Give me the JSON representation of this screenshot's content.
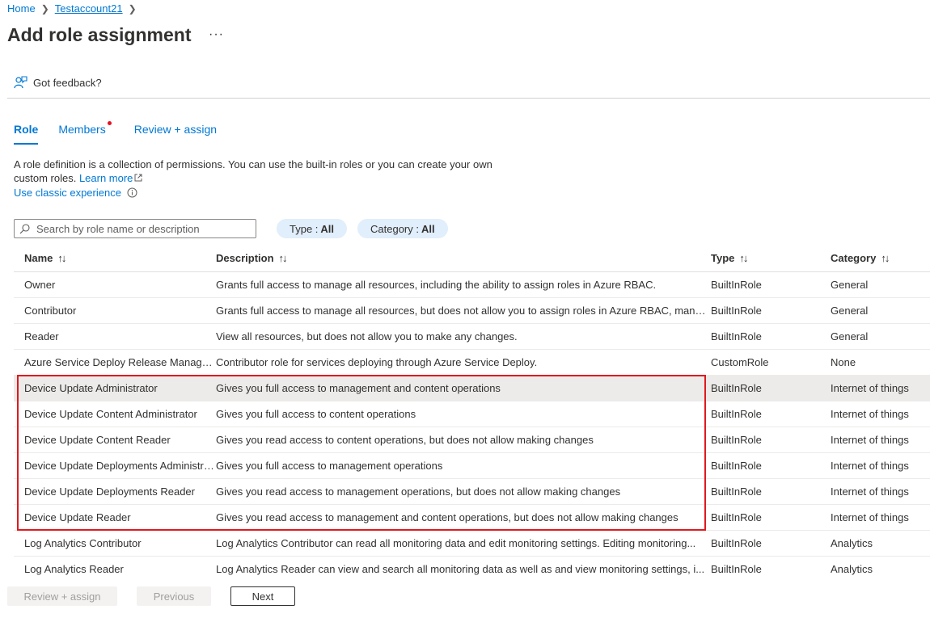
{
  "breadcrumb": {
    "home": "Home",
    "current": "Testaccount21"
  },
  "page": {
    "title": "Add role assignment",
    "more": "···"
  },
  "feedback": {
    "label": "Got feedback?"
  },
  "tabs": [
    {
      "label": "Role"
    },
    {
      "label": "Members"
    },
    {
      "label": "Review + assign"
    }
  ],
  "intro": {
    "text": "A role definition is a collection of permissions. You can use the built-in roles or you can create your own custom roles.",
    "learn_more": "Learn more",
    "classic": "Use classic experience"
  },
  "search": {
    "placeholder": "Search by role name or description"
  },
  "filters": {
    "type": {
      "label": "Type :",
      "value": "All"
    },
    "category": {
      "label": "Category :",
      "value": "All"
    }
  },
  "table": {
    "headers": {
      "name": "Name",
      "description": "Description",
      "type": "Type",
      "category": "Category"
    },
    "rows": [
      {
        "name": "Owner",
        "description": "Grants full access to manage all resources, including the ability to assign roles in Azure RBAC.",
        "type": "BuiltInRole",
        "category": "General"
      },
      {
        "name": "Contributor",
        "description": "Grants full access to manage all resources, but does not allow you to assign roles in Azure RBAC, manag...",
        "type": "BuiltInRole",
        "category": "General"
      },
      {
        "name": "Reader",
        "description": "View all resources, but does not allow you to make any changes.",
        "type": "BuiltInRole",
        "category": "General"
      },
      {
        "name": "Azure Service Deploy Release Managem...",
        "description": "Contributor role for services deploying through Azure Service Deploy.",
        "type": "CustomRole",
        "category": "None"
      },
      {
        "name": "Device Update Administrator",
        "description": "Gives you full access to management and content operations",
        "type": "BuiltInRole",
        "category": "Internet of things"
      },
      {
        "name": "Device Update Content Administrator",
        "description": "Gives you full access to content operations",
        "type": "BuiltInRole",
        "category": "Internet of things"
      },
      {
        "name": "Device Update Content Reader",
        "description": "Gives you read access to content operations, but does not allow making changes",
        "type": "BuiltInRole",
        "category": "Internet of things"
      },
      {
        "name": "Device Update Deployments Administra...",
        "description": "Gives you full access to management operations",
        "type": "BuiltInRole",
        "category": "Internet of things"
      },
      {
        "name": "Device Update Deployments Reader",
        "description": "Gives you read access to management operations, but does not allow making changes",
        "type": "BuiltInRole",
        "category": "Internet of things"
      },
      {
        "name": "Device Update Reader",
        "description": "Gives you read access to management and content operations, but does not allow making changes",
        "type": "BuiltInRole",
        "category": "Internet of things"
      },
      {
        "name": "Log Analytics Contributor",
        "description": "Log Analytics Contributor can read all monitoring data and edit monitoring settings. Editing monitoring...",
        "type": "BuiltInRole",
        "category": "Analytics"
      },
      {
        "name": "Log Analytics Reader",
        "description": "Log Analytics Reader can view and search all monitoring data as well as and view monitoring settings, i...",
        "type": "BuiltInRole",
        "category": "Analytics"
      }
    ]
  },
  "footer": {
    "review": "Review + assign",
    "previous": "Previous",
    "next": "Next"
  },
  "colors": {
    "accent": "#0078d4",
    "highlight_border": "#e0191e",
    "pill_bg": "#e1eefb"
  }
}
